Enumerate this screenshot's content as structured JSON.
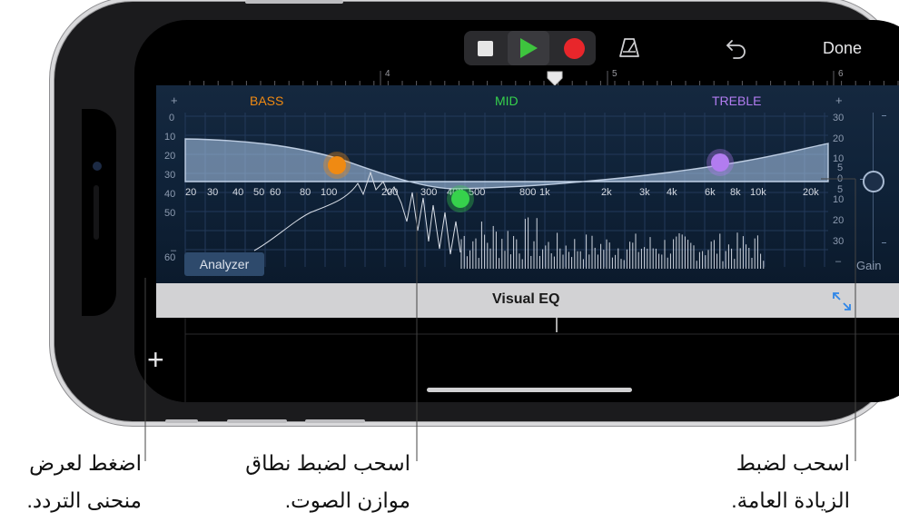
{
  "toolbar": {
    "done_label": "Done"
  },
  "ruler": {
    "marks": [
      "4",
      "5",
      "6"
    ]
  },
  "eq": {
    "bands": {
      "bass": "BASS",
      "mid": "MID",
      "treble": "TREBLE"
    },
    "db_left": [
      "0",
      "10",
      "20",
      "30",
      "40",
      "50",
      "60"
    ],
    "db_right": [
      "30",
      "20",
      "10",
      "5",
      "0",
      "5",
      "10",
      "20",
      "30"
    ],
    "freq_labels": [
      "20",
      "30",
      "40",
      "50",
      "60",
      "80",
      "100",
      "200",
      "300",
      "400",
      "500",
      "800",
      "1k",
      "2k",
      "3k",
      "4k",
      "6k",
      "8k",
      "10k",
      "20k"
    ],
    "plus_left": "+",
    "plus_right": "+",
    "minus_left": "–",
    "minus_right": "–",
    "analyzer_label": "Analyzer",
    "gain_label": "Gain"
  },
  "visual_eq": {
    "title": "Visual EQ"
  },
  "tracks": {
    "add_label": "+"
  },
  "callouts": {
    "analyzer": "اضغط لعرض منحنى التردد.",
    "band": "اسحب لضبط نطاق موازن الصوت.",
    "gain": "اسحب لضبط الزيادة العامة."
  },
  "colors": {
    "bass": "#f08a12",
    "mid": "#36d24c",
    "treble": "#b27cf0",
    "record": "#e8262b",
    "play": "#3ec43e",
    "accent": "#2f86e8"
  }
}
